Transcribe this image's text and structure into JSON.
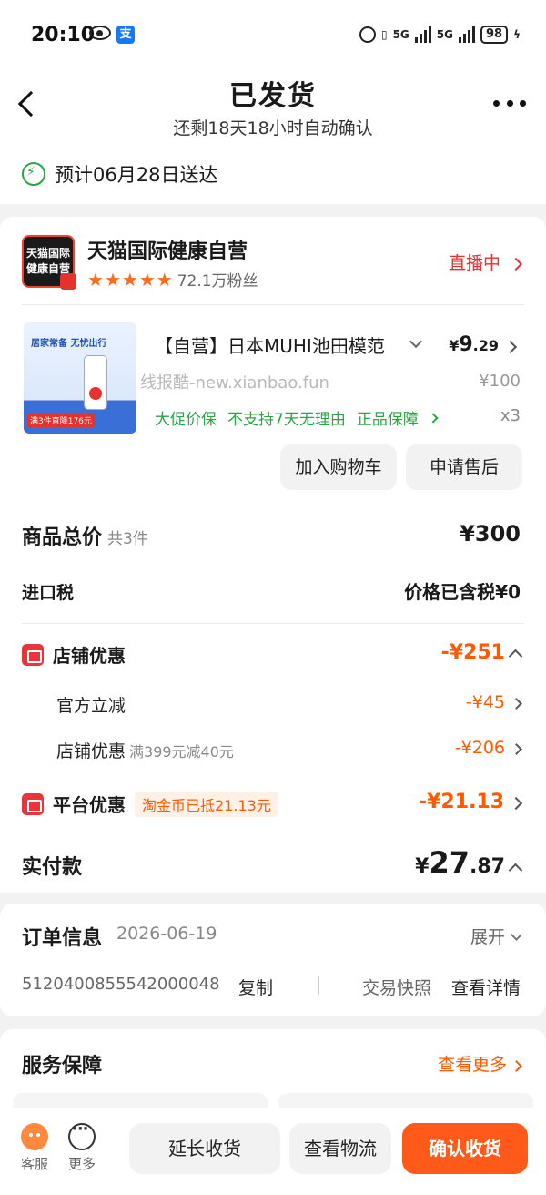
{
  "status_bar": {
    "time": "20:10",
    "network_1": "5G",
    "network_2": "5G",
    "battery": "98",
    "icons": [
      "eye-icon",
      "alipay-icon",
      "alarm-icon",
      "vibrate-icon",
      "signal-icon",
      "battery-icon",
      "charging-icon"
    ]
  },
  "header": {
    "title": "已发货",
    "subtitle": "还剩18天18小时自动确认",
    "eta": "预计06月28日送达"
  },
  "shop": {
    "logo_line1": "天猫国际",
    "logo_line2": "健康自营",
    "name": "天猫国际健康自营",
    "rating_stars": 5,
    "fans": "72.1万粉丝",
    "live_label": "直播中"
  },
  "product": {
    "image_text": "居家常备 无忧出行",
    "image_badge": "满3件直降176元",
    "title": "【自营】日本MUHI池田模范",
    "price_symbol": "¥",
    "price_int": "9",
    "price_dec": ".29",
    "original_price": "¥100",
    "guarantees": [
      "大促价保",
      "不支持7天无理由",
      "正品保障"
    ],
    "quantity": "x3",
    "add_cart": "加入购物车",
    "after_sale": "申请售后"
  },
  "watermark": "线报酷-new.xianbao.fun",
  "summary": {
    "total_label": "商品总价",
    "total_count": "共3件",
    "total_value": "¥300",
    "tax_label": "进口税",
    "tax_value": "价格已含税¥0"
  },
  "discounts": {
    "shop_label": "店铺优惠",
    "shop_value": "-¥251",
    "official_label": "官方立减",
    "official_value": "-¥45",
    "store_label": "店铺优惠",
    "store_note": "满399元减40元",
    "store_value": "-¥206",
    "platform_label": "平台优惠",
    "platform_badge": "淘金币已抵21.13元",
    "platform_value": "-¥21.13"
  },
  "payment": {
    "label": "实付款",
    "symbol": "¥",
    "int": "27",
    "dec": ".87"
  },
  "order_info": {
    "title": "订单信息",
    "date": "2026-06-19",
    "expand": "展开",
    "order_number": "5120400855542000048",
    "copy": "复制",
    "snapshot": "交易快照",
    "details": "查看详情"
  },
  "service": {
    "title": "服务保障",
    "more": "查看更多"
  },
  "bottom_bar": {
    "service": "客服",
    "more": "更多",
    "extend": "延长收货",
    "logistics": "查看物流",
    "confirm": "确认收货"
  },
  "colors": {
    "accent": "#ff5a1a",
    "price_red": "#ff5a00",
    "green": "#2aa745",
    "live_red": "#e4322d"
  }
}
